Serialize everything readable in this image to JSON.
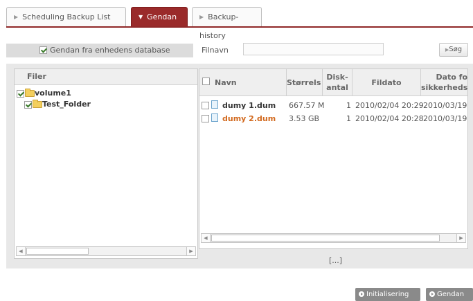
{
  "tabs": [
    {
      "label": "Scheduling Backup List",
      "active": false
    },
    {
      "label": "Gendan",
      "active": true
    },
    {
      "label": "Backup-history",
      "active": false
    }
  ],
  "filter": {
    "db_checkbox_label": "Gendan fra enhedens database",
    "db_checked": true,
    "filename_label": "Filnavn",
    "filename_value": "",
    "search_button": "Søg"
  },
  "tree": {
    "header": "Filer",
    "items": [
      {
        "label": "volume1",
        "checked": true,
        "level": 0
      },
      {
        "label": "Test_Folder",
        "checked": true,
        "level": 1
      }
    ]
  },
  "files": {
    "columns": [
      "Navn",
      "Størrelse",
      "Disk-antal",
      "Fildato",
      "Dato for sikkerhedskopi"
    ],
    "col_size_cut": "Størrels",
    "col_disk_1": "Disk-",
    "col_disk_2": "antal",
    "col_bdate_1": "Dato fo",
    "col_bdate_2": "sikkerheds",
    "rows": [
      {
        "name": "dumy 1.dum",
        "size": "667.57 M",
        "disks": "1",
        "file_date": "2010/02/04 20:29",
        "backup_date": "2010/03/19",
        "selected": false
      },
      {
        "name": "dumy 2.dum",
        "size": "3.53 GB",
        "disks": "1",
        "file_date": "2010/02/04 20:28",
        "backup_date": "2010/03/19",
        "selected": true
      }
    ]
  },
  "pager": "[...]",
  "buttons": {
    "init": "Initialisering",
    "restore": "Gendan"
  },
  "colors": {
    "accent": "#9a2a2a",
    "highlight_file": "#d2691e",
    "panel_bg": "#e8e8e8"
  }
}
